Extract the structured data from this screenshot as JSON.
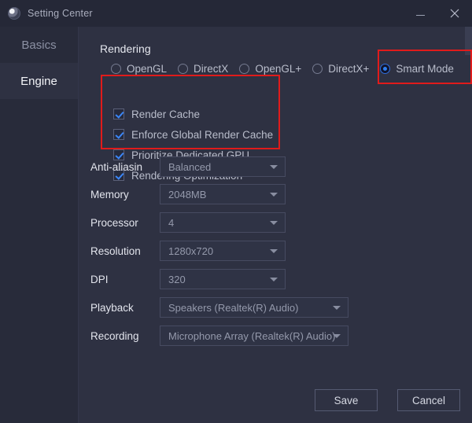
{
  "window": {
    "title": "Setting Center",
    "app_icon": "app-logo-icon",
    "minimize_label": "–",
    "close_label": "✕"
  },
  "sidebar": {
    "items": [
      {
        "label": "Basics",
        "active": false
      },
      {
        "label": "Engine",
        "active": true
      }
    ]
  },
  "main": {
    "section_title": "Rendering",
    "render_modes": [
      {
        "label": "OpenGL",
        "selected": false
      },
      {
        "label": "DirectX",
        "selected": false
      },
      {
        "label": "OpenGL+",
        "selected": false
      },
      {
        "label": "DirectX+",
        "selected": false
      },
      {
        "label": "Smart Mode",
        "selected": true
      }
    ],
    "render_options": [
      {
        "label": "Render Cache",
        "checked": true
      },
      {
        "label": "Enforce Global Render Cache",
        "checked": true
      },
      {
        "label": "Prioritize Dedicated GPU",
        "checked": true
      },
      {
        "label": "Rendering Optimization",
        "checked": true
      }
    ],
    "settings": [
      {
        "label": "Anti-aliasin",
        "value": "Balanced",
        "width": "w160"
      },
      {
        "label": "Memory",
        "value": "2048MB",
        "width": "w160"
      },
      {
        "label": "Processor",
        "value": "4",
        "width": "w160"
      },
      {
        "label": "Resolution",
        "value": "1280x720",
        "width": "w160"
      },
      {
        "label": "DPI",
        "value": "320",
        "width": "w160"
      },
      {
        "label": "Playback",
        "value": "Speakers (Realtek(R) Audio)",
        "width": "w240"
      },
      {
        "label": "Recording",
        "value": "Microphone Array (Realtek(R) Audio)",
        "width": "w240"
      }
    ]
  },
  "footer": {
    "save_label": "Save",
    "cancel_label": "Cancel"
  },
  "annotations": {
    "accent_red": "#e01b1b",
    "boxes": [
      "render-options-highlight",
      "smart-mode-highlight"
    ]
  }
}
